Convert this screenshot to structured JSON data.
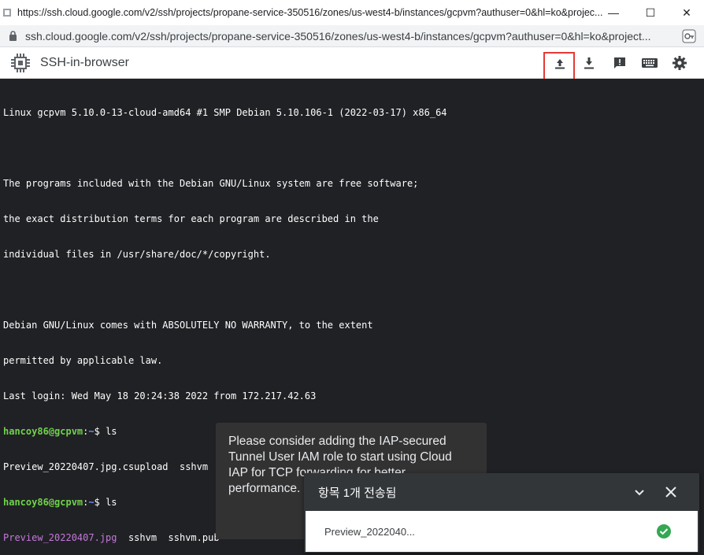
{
  "window": {
    "title": "https://ssh.cloud.google.com/v2/ssh/projects/propane-service-350516/zones/us-west4-b/instances/gcpvm?authuser=0&hl=ko&projec...",
    "minimize_glyph": "—",
    "maximize_glyph": "☐",
    "close_glyph": "✕"
  },
  "address_bar": {
    "url": "ssh.cloud.google.com/v2/ssh/projects/propane-service-350516/zones/us-west4-b/instances/gcpvm?authuser=0&hl=ko&project..."
  },
  "app": {
    "title": "SSH-in-browser",
    "toolbar": [
      {
        "name": "upload-file-icon",
        "highlighted": true
      },
      {
        "name": "download-file-icon"
      },
      {
        "name": "feedback-icon"
      },
      {
        "name": "keyboard-icon"
      },
      {
        "name": "settings-gear-icon"
      }
    ],
    "highlight_color": "#e53935"
  },
  "terminal": {
    "colors": {
      "user": "#6fd34b",
      "path": "#6f8cff",
      "image_file": "#c678dd",
      "text": "#ffffff",
      "background": "#202124"
    },
    "banner_lines": [
      "Linux gcpvm 5.10.0-13-cloud-amd64 #1 SMP Debian 5.10.106-1 (2022-03-17) x86_64",
      "",
      "The programs included with the Debian GNU/Linux system are free software;",
      "the exact distribution terms for each program are described in the",
      "individual files in /usr/share/doc/*/copyright.",
      "",
      "Debian GNU/Linux comes with ABSOLUTELY NO WARRANTY, to the extent",
      "permitted by applicable law.",
      "Last login: Wed May 18 20:24:38 2022 from 172.217.42.63"
    ],
    "prompt_user": "hancoy86@gcpvm",
    "prompt_sep": ":",
    "prompt_path": "~",
    "prompt_symbol": "$ ",
    "command1": "ls",
    "output1": "Preview_20220407.jpg.csupload  sshvm  sshvm.pub",
    "command2": "ls",
    "output2_image": "Preview_20220407.jpg",
    "output2_rest": "  sshvm  sshvm.pub"
  },
  "toast": {
    "message": "Please consider adding the IAP-secured Tunnel User IAM role to start using Cloud IAP for TCP forwarding for better performance."
  },
  "download_panel": {
    "header": "항목 1개 전송됨",
    "file_name": "Preview_2022040...",
    "status_color": "#34a853"
  }
}
